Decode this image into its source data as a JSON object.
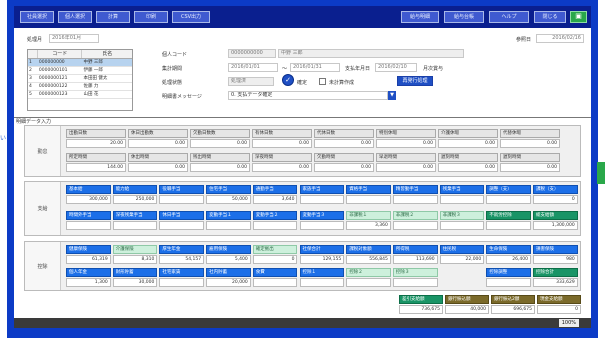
{
  "toolbar": {
    "buttons": [
      "社員選択",
      "個人選択",
      "計算",
      "印刷",
      "CSV出力"
    ],
    "right_buttons": [
      "給与明細",
      "給与台帳",
      "ヘルプ",
      "閉じる"
    ],
    "right_icon": "monitor-icon",
    "ref_label": "参照日",
    "ref_value": "2016/02/16",
    "accent": "#0a1f8f"
  },
  "left_peek": "い",
  "header": {
    "period_label": "処理月",
    "period_value": "2016年01月",
    "list_col_code": "コード",
    "list_col_name": "氏名",
    "employees": [
      {
        "no": "1",
        "code": "000000000",
        "name": "中野 三郎",
        "selected": true
      },
      {
        "no": "2",
        "code": "0000000101",
        "name": "伊藤 一郎",
        "selected": false
      },
      {
        "no": "3",
        "code": "0000000121",
        "name": "本田田 健太",
        "selected": false
      },
      {
        "no": "4",
        "code": "0000000122",
        "name": "佐藤 力",
        "selected": false
      },
      {
        "no": "5",
        "code": "0000000123",
        "name": "山田 花",
        "selected": false
      }
    ],
    "person_code_label": "個人コード",
    "person_code_value": "0000000000",
    "person_name_value": "中野 三郎",
    "calc_period_label": "集計期間",
    "calc_from": "2016/01/01",
    "calc_sep": "〜",
    "calc_to": "2016/01/31",
    "pay_date_label": "支払年月日",
    "pay_date_value": "2016/02/10",
    "pay_type_value": "月次賞与",
    "status_label": "処理状態",
    "status_value": "処理済",
    "confirm_label": "確定",
    "unconfirmed_label": "未計算作成",
    "message_label": "明細書メッセージ",
    "message_value": "0. 支払データ確定",
    "reissue_button": "再発行処理"
  },
  "tab": {
    "label": "明細データ入力"
  },
  "sections": {
    "attendance": {
      "label": "勤怠",
      "rows": [
        {
          "labels": [
            "出勤日数",
            "休日出勤数",
            "欠勤日数数",
            "有休日数",
            "代休日数",
            "特別休暇",
            "介護休暇",
            "代替休暇"
          ],
          "values": [
            "20.00",
            "0.00",
            "0.00",
            "0.00",
            "0.00",
            "0.00",
            "0.00",
            "0.00"
          ]
        },
        {
          "labels": [
            "所定時間",
            "休出時間",
            "残出時間",
            "深夜時間",
            "欠勤時間",
            "早退時間",
            "遅刻時間",
            "遅刻時間"
          ],
          "values": [
            "144.00",
            "0.00",
            "0.00",
            "0.00",
            "0.00",
            "0.00",
            "0.00",
            "0.00"
          ]
        }
      ]
    },
    "payment": {
      "label": "支給",
      "row1_labels": [
        "基本給",
        "能力給",
        "役職手当",
        "住宅手当",
        "通勤手当",
        "家族手当",
        "資格手当",
        "精皆勤手当",
        "残業手当",
        "調整（支）",
        "課税（支）"
      ],
      "row1_colors": [
        "b",
        "b",
        "b",
        "b",
        "b",
        "b",
        "b",
        "b",
        "b",
        "b",
        "b"
      ],
      "row1_values": [
        "300,000",
        "250,000",
        "",
        "50,000",
        "3,640",
        "",
        "",
        "",
        "",
        "",
        "0"
      ],
      "row2_labels": [
        "時間外手当",
        "深夜残業手当",
        "休日手当",
        "変動手当１",
        "変動手当２",
        "変動手当３",
        "非課税１",
        "非課税２",
        "非課税３",
        "不就労控除",
        "総支給額"
      ],
      "row2_colors": [
        "b",
        "b",
        "b",
        "b",
        "b",
        "b",
        "lg",
        "lg",
        "lg",
        "gr",
        "gr"
      ],
      "row2_values": [
        "",
        "",
        "",
        "",
        "",
        "",
        "3,360",
        "",
        "",
        "",
        "1,300,000"
      ]
    },
    "deduction": {
      "label": "控除",
      "row1_labels": [
        "健康保険",
        "介護保険",
        "厚生年金",
        "雇用保険",
        "確定拠出",
        "社保合計",
        "課税対象額",
        "所得税",
        "住民税",
        "生命保険",
        "損害保険"
      ],
      "row1_colors": [
        "b",
        "lg",
        "b",
        "b",
        "lg",
        "b",
        "b",
        "b",
        "b",
        "b",
        "b"
      ],
      "row1_values": [
        "61,319",
        "8,310",
        "54,157",
        "5,400",
        "0",
        "129,155",
        "556,845",
        "113,690",
        "22,000",
        "26,400",
        "980"
      ],
      "row2_labels": [
        "個人年金",
        "財形貯蓄",
        "社宅家賃",
        "社内貯蓄",
        "食費",
        "控除１",
        "控除２",
        "控除３",
        "",
        "控除調整",
        "控除合計"
      ],
      "row2_colors": [
        "b",
        "b",
        "b",
        "b",
        "b",
        "b",
        "lg",
        "lg",
        "none",
        "b",
        "gr"
      ],
      "row2_values": [
        "1,300",
        "30,000",
        "",
        "20,000",
        "",
        "",
        "",
        "",
        "",
        "",
        "333,629"
      ]
    },
    "summary": {
      "labels": [
        "差引支給額",
        "銀行振込額",
        "銀行振込2額",
        "現金支給額"
      ],
      "colors": [
        "gr",
        "o",
        "o",
        "o"
      ],
      "values": [
        "736,675",
        "40,000",
        "696,675",
        "0"
      ]
    }
  },
  "statusbar": {
    "zoom": "100%",
    "bg": "#3a3a3a"
  }
}
